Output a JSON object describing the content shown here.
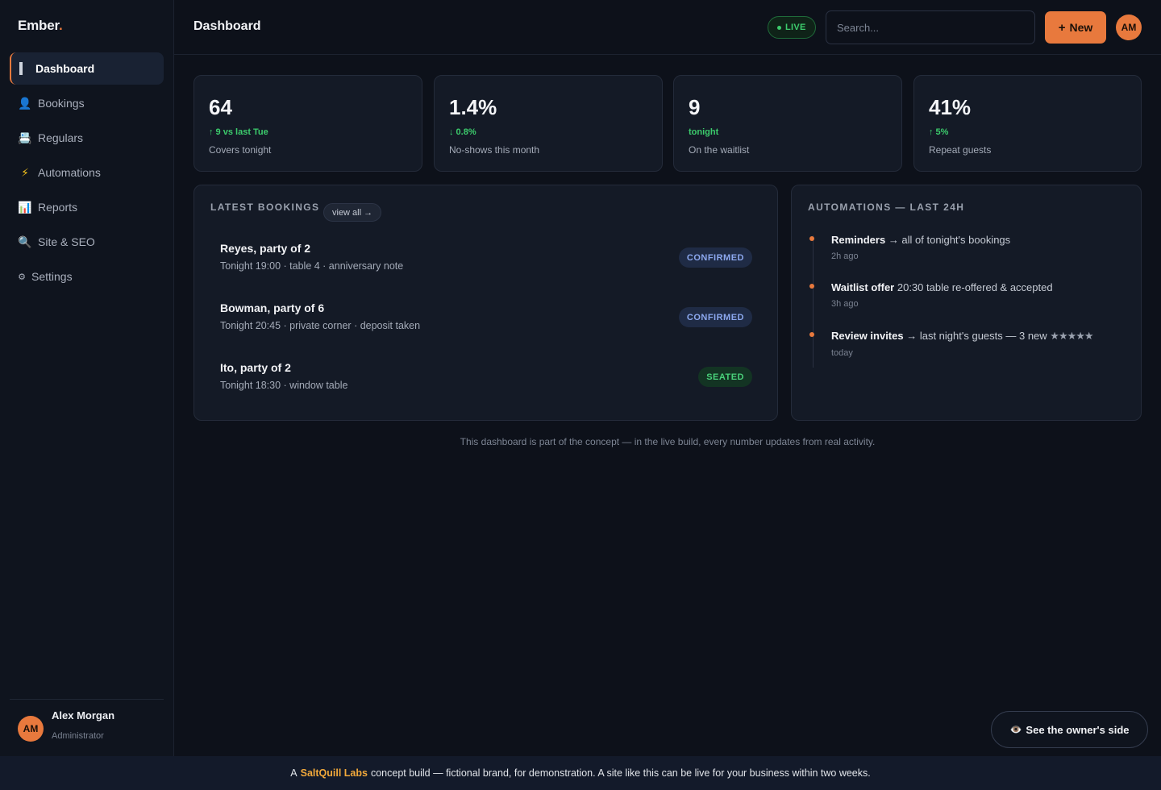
{
  "brand": {
    "name": "Ember",
    "dot": "."
  },
  "sidebar": {
    "items": [
      {
        "label": "Dashboard",
        "icon": "grid-icon",
        "glyph": ""
      },
      {
        "label": "Bookings",
        "icon": "user-icon",
        "glyph": "👤"
      },
      {
        "label": "Regulars",
        "icon": "cash-register-icon",
        "glyph": "📇"
      },
      {
        "label": "Automations",
        "icon": "lightning-icon",
        "glyph": "⚡"
      },
      {
        "label": "Reports",
        "icon": "bar-chart-icon",
        "glyph": "📊"
      },
      {
        "label": "Site & SEO",
        "icon": "magnifier-icon",
        "glyph": "🔍"
      },
      {
        "label": "Settings",
        "icon": "gear-icon",
        "glyph": "⚙"
      }
    ],
    "user": {
      "initials": "AM",
      "name": "Alex Morgan",
      "role": "Administrator"
    }
  },
  "header": {
    "title": "Dashboard",
    "live_label": "LIVE",
    "search_placeholder": "Search...",
    "new_label": "New",
    "avatar_initials": "AM"
  },
  "stats": [
    {
      "value": "64",
      "delta": "↑ 9 vs last Tue",
      "label": "Covers tonight"
    },
    {
      "value": "1.4%",
      "delta": "↓ 0.8%",
      "label": "No-shows this month"
    },
    {
      "value": "9",
      "delta": "tonight",
      "label": "On the waitlist"
    },
    {
      "value": "41%",
      "delta": "↑ 5%",
      "label": "Repeat guests"
    }
  ],
  "bookings": {
    "title": "LATEST BOOKINGS",
    "view_all": "view all →",
    "rows": [
      {
        "name": "Reyes, party of 2",
        "detail": "Tonight 19:00 · table 4 · anniversary note",
        "status": "CONFIRMED"
      },
      {
        "name": "Bowman, party of 6",
        "detail": "Tonight 20:45 · private corner · deposit taken",
        "status": "CONFIRMED"
      },
      {
        "name": "Ito, party of 2",
        "detail": "Tonight 18:30 · window table",
        "status": "SEATED"
      }
    ]
  },
  "automations": {
    "title": "AUTOMATIONS — LAST 24H",
    "events": [
      {
        "name": "Reminders",
        "text": " → all of tonight's bookings",
        "stars": "",
        "time": "2h ago"
      },
      {
        "name": "Waitlist offer",
        "text": " 20:30 table re-offered & accepted",
        "stars": "",
        "time": "3h ago"
      },
      {
        "name": "Review invites",
        "text": " → last night's guests — 3 new ",
        "stars": "★★★★★",
        "time": "today"
      }
    ]
  },
  "footnote": "This dashboard is part of the concept — in the live build, every number updates from real activity.",
  "owner_button": {
    "icon": "eye-icon",
    "label": "See the owner's side"
  },
  "bottom_bar": {
    "prefix": "A",
    "brand": "SaltQuill Labs",
    "suffix": "concept build — fictional brand, for demonstration. A site like this can be live for your business within two weeks."
  },
  "colors": {
    "accent": "#e8793d",
    "positive": "#3ccb6c",
    "confirmed": "#8ca8ef",
    "seated": "#49d17a",
    "brand_highlight": "#f2a93b"
  }
}
